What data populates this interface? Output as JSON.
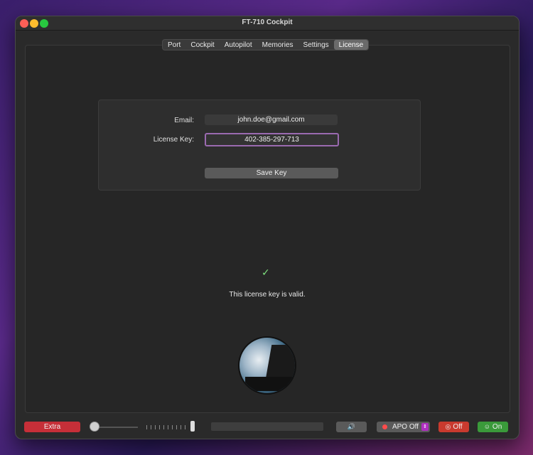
{
  "window": {
    "title": "FT-710 Cockpit"
  },
  "tabs": [
    {
      "label": "Port"
    },
    {
      "label": "Cockpit"
    },
    {
      "label": "Autopilot"
    },
    {
      "label": "Memories"
    },
    {
      "label": "Settings"
    },
    {
      "label": "License"
    }
  ],
  "active_tab": "License",
  "license": {
    "email_label": "Email:",
    "email_value": "john.doe@gmail.com",
    "key_label": "License Key:",
    "key_value": "402-385-297-713",
    "save_label": "Save Key",
    "valid_message": "This license key is valid."
  },
  "icons": {
    "check": "✓",
    "speaker": "🔊"
  },
  "bottombar": {
    "extra_label": "Extra",
    "apo_label": "APO Off",
    "off_label": "Off",
    "on_label": "On"
  },
  "colors": {
    "accent_focus": "#9a6ab0",
    "extra": "#c62f38",
    "off": "#c93a2e",
    "on": "#3a9a3a",
    "valid_check": "#7ee07e"
  }
}
